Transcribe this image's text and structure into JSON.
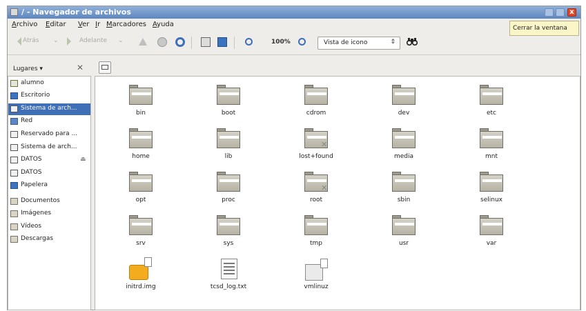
{
  "window": {
    "title": "/ - Navegador de archivos",
    "close_glyph": "x",
    "tooltip": "Cerrar la ventana"
  },
  "menubar": {
    "items": [
      {
        "label": "Archivo"
      },
      {
        "label": "Editar"
      },
      {
        "label": "Ver"
      },
      {
        "label": "Ir"
      },
      {
        "label": "Marcadores"
      },
      {
        "label": "Ayuda"
      }
    ]
  },
  "toolbar": {
    "back_label": "Atrás",
    "forward_label": "Adelante",
    "zoom_level": "100%",
    "view_mode": "Vista de icono",
    "select_arrow": "⇕"
  },
  "sidebar": {
    "header": "Lugares",
    "close_glyph": "✕",
    "items": [
      {
        "label": "alumno",
        "icon": "home-folder-icon"
      },
      {
        "label": "Escritorio",
        "icon": "desktop-icon"
      },
      {
        "label": "Sistema de arch...",
        "icon": "drive-icon",
        "selected": true
      },
      {
        "label": "Red",
        "icon": "network-icon"
      },
      {
        "label": "Reservado para ...",
        "icon": "drive-icon"
      },
      {
        "label": "Sistema de arch...",
        "icon": "drive-icon"
      },
      {
        "label": "DATOS",
        "icon": "drive-icon",
        "eject": "⏏"
      },
      {
        "label": "DATOS",
        "icon": "drive-icon"
      },
      {
        "label": "Papelera",
        "icon": "trash-icon"
      },
      {
        "label": "Documentos",
        "icon": "folder-icon"
      },
      {
        "label": "Imágenes",
        "icon": "folder-icon"
      },
      {
        "label": "Vídeos",
        "icon": "folder-icon"
      },
      {
        "label": "Descargas",
        "icon": "folder-icon"
      }
    ]
  },
  "files": [
    {
      "name": "bin",
      "type": "folder"
    },
    {
      "name": "boot",
      "type": "folder"
    },
    {
      "name": "cdrom",
      "type": "folder"
    },
    {
      "name": "dev",
      "type": "folder"
    },
    {
      "name": "etc",
      "type": "folder"
    },
    {
      "name": "home",
      "type": "folder"
    },
    {
      "name": "lib",
      "type": "folder"
    },
    {
      "name": "lost+found",
      "type": "folder-locked"
    },
    {
      "name": "media",
      "type": "folder"
    },
    {
      "name": "mnt",
      "type": "folder"
    },
    {
      "name": "opt",
      "type": "folder"
    },
    {
      "name": "proc",
      "type": "folder"
    },
    {
      "name": "root",
      "type": "folder-locked"
    },
    {
      "name": "sbin",
      "type": "folder"
    },
    {
      "name": "selinux",
      "type": "folder"
    },
    {
      "name": "srv",
      "type": "folder"
    },
    {
      "name": "sys",
      "type": "folder"
    },
    {
      "name": "tmp",
      "type": "folder"
    },
    {
      "name": "usr",
      "type": "folder"
    },
    {
      "name": "var",
      "type": "folder"
    },
    {
      "name": "initrd.img",
      "type": "package-link"
    },
    {
      "name": "tcsd_log.txt",
      "type": "text-file"
    },
    {
      "name": "vmlinuz",
      "type": "binary-link"
    }
  ],
  "colors": {
    "selection": "#3f6fb6",
    "titlebar": "#5d86bf",
    "close_button": "#e0482a",
    "tooltip_bg": "#fbf6c8"
  }
}
